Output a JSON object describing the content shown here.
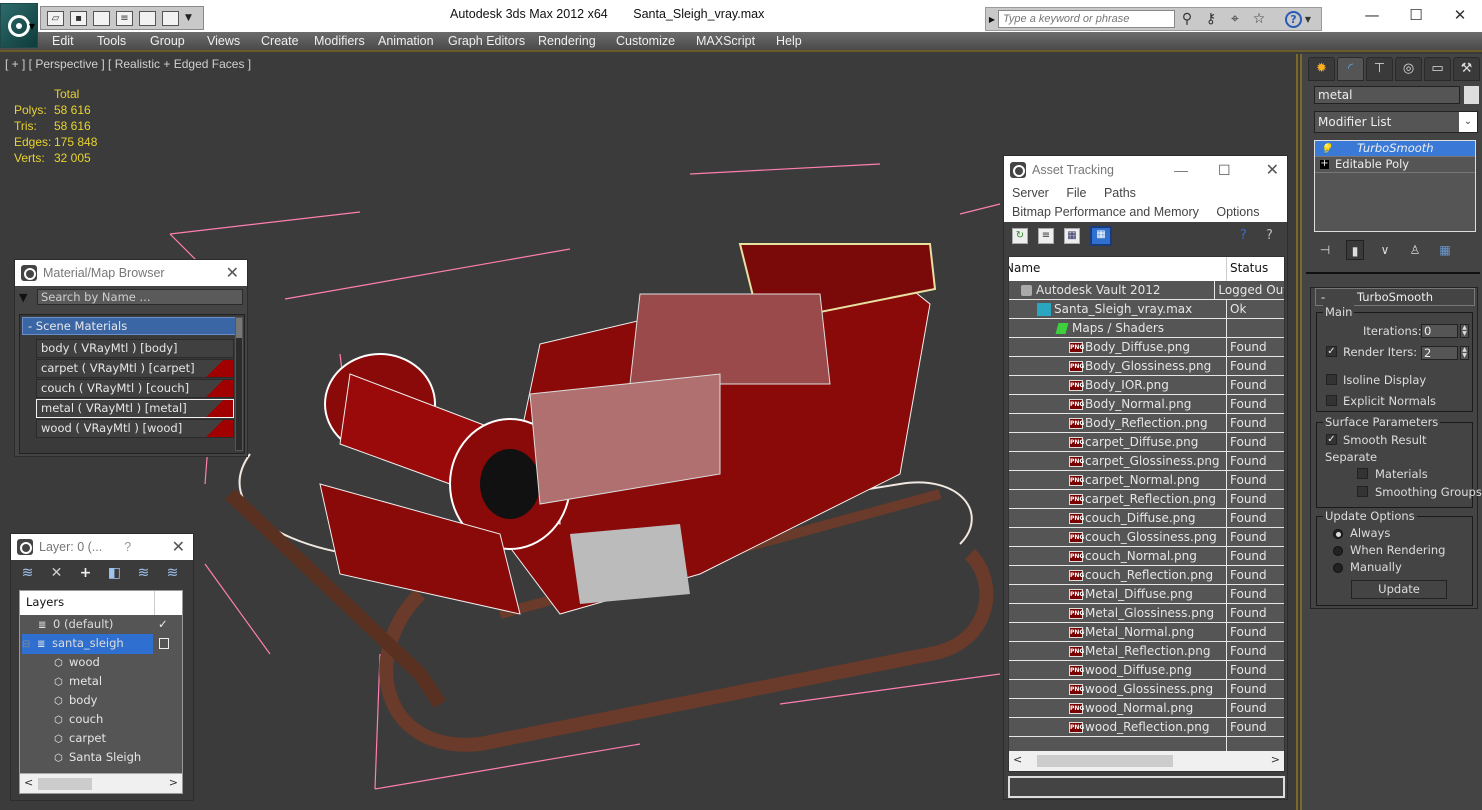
{
  "titlebar": {
    "app_name": "Autodesk 3ds Max  2012 x64",
    "file_name": "Santa_Sleigh_vray.max",
    "search_placeholder": "Type a keyword or phrase",
    "icons": [
      "search-binoculars-icon",
      "key-icon",
      "satellite-icon",
      "star-icon",
      "help-icon"
    ],
    "window_controls": [
      "minimize",
      "maximize",
      "close"
    ]
  },
  "quick_access": [
    "open-icon",
    "save-icon",
    "new-icon",
    "project-icon",
    "undo-icon",
    "redo-icon",
    "dropdown-icon"
  ],
  "menu": [
    "Edit",
    "Tools",
    "Group",
    "Views",
    "Create",
    "Modifiers",
    "Animation",
    "Graph Editors",
    "Rendering",
    "Customize",
    "MAXScript",
    "Help"
  ],
  "viewport": {
    "label": "[ + ] [ Perspective ] [ Realistic + Edged Faces ]",
    "stats": {
      "header": "Total",
      "rows": [
        {
          "key": "Polys:",
          "value": "58 616"
        },
        {
          "key": "Tris:",
          "value": "58 616"
        },
        {
          "key": "Edges:",
          "value": "175 848"
        },
        {
          "key": "Verts:",
          "value": "32 005"
        }
      ]
    }
  },
  "material_browser": {
    "title": "Material/Map Browser",
    "search_placeholder": "Search by Name ...",
    "group": "- Scene Materials",
    "items": [
      {
        "label": "body  ( VRayMtl ) [body]",
        "swatch": false,
        "selected": false
      },
      {
        "label": "carpet  ( VRayMtl ) [carpet]",
        "swatch": true,
        "selected": false
      },
      {
        "label": "couch  ( VRayMtl ) [couch]",
        "swatch": true,
        "selected": false
      },
      {
        "label": "metal  ( VRayMtl ) [metal]",
        "swatch": true,
        "selected": true
      },
      {
        "label": "wood  ( VRayMtl ) [wood]",
        "swatch": true,
        "selected": false
      }
    ]
  },
  "layer_explorer": {
    "title": "Layer: 0 (...",
    "help": "?",
    "header": "Layers",
    "rows": [
      {
        "label": "0 (default)",
        "type": "layer",
        "indent": 1,
        "selected": false,
        "state": "check"
      },
      {
        "label": "santa_sleigh",
        "type": "layer",
        "indent": 0,
        "selected": true,
        "state": "box"
      },
      {
        "label": "wood",
        "type": "object",
        "indent": 2
      },
      {
        "label": "metal",
        "type": "object",
        "indent": 2
      },
      {
        "label": "body",
        "type": "object",
        "indent": 2
      },
      {
        "label": "couch",
        "type": "object",
        "indent": 2
      },
      {
        "label": "carpet",
        "type": "object",
        "indent": 2
      },
      {
        "label": "Santa Sleigh",
        "type": "object",
        "indent": 2
      }
    ]
  },
  "asset_tracking": {
    "title": "Asset Tracking",
    "menu1": [
      "Server",
      "File",
      "Paths"
    ],
    "menu2": [
      "Bitmap Performance and Memory",
      "Options"
    ],
    "columns": [
      "Name",
      "Status"
    ],
    "rows": [
      {
        "name": "Autodesk Vault 2012",
        "status": "Logged Out",
        "icon": "vault",
        "indent": 1
      },
      {
        "name": "Santa_Sleigh_vray.max",
        "status": "Ok",
        "icon": "max",
        "indent": 2
      },
      {
        "name": "Maps / Shaders",
        "status": "",
        "icon": "maps",
        "indent": 3
      },
      {
        "name": "Body_Diffuse.png",
        "status": "Found",
        "icon": "png",
        "indent": 4
      },
      {
        "name": "Body_Glossiness.png",
        "status": "Found",
        "icon": "png",
        "indent": 4
      },
      {
        "name": "Body_IOR.png",
        "status": "Found",
        "icon": "png",
        "indent": 4
      },
      {
        "name": "Body_Normal.png",
        "status": "Found",
        "icon": "png",
        "indent": 4
      },
      {
        "name": "Body_Reflection.png",
        "status": "Found",
        "icon": "png",
        "indent": 4
      },
      {
        "name": "carpet_Diffuse.png",
        "status": "Found",
        "icon": "png",
        "indent": 4
      },
      {
        "name": "carpet_Glossiness.png",
        "status": "Found",
        "icon": "png",
        "indent": 4
      },
      {
        "name": "carpet_Normal.png",
        "status": "Found",
        "icon": "png",
        "indent": 4
      },
      {
        "name": "carpet_Reflection.png",
        "status": "Found",
        "icon": "png",
        "indent": 4
      },
      {
        "name": "couch_Diffuse.png",
        "status": "Found",
        "icon": "png",
        "indent": 4
      },
      {
        "name": "couch_Glossiness.png",
        "status": "Found",
        "icon": "png",
        "indent": 4
      },
      {
        "name": "couch_Normal.png",
        "status": "Found",
        "icon": "png",
        "indent": 4
      },
      {
        "name": "couch_Reflection.png",
        "status": "Found",
        "icon": "png",
        "indent": 4
      },
      {
        "name": "Metal_Diffuse.png",
        "status": "Found",
        "icon": "png",
        "indent": 4
      },
      {
        "name": "Metal_Glossiness.png",
        "status": "Found",
        "icon": "png",
        "indent": 4
      },
      {
        "name": "Metal_Normal.png",
        "status": "Found",
        "icon": "png",
        "indent": 4
      },
      {
        "name": "Metal_Reflection.png",
        "status": "Found",
        "icon": "png",
        "indent": 4
      },
      {
        "name": "wood_Diffuse.png",
        "status": "Found",
        "icon": "png",
        "indent": 4
      },
      {
        "name": "wood_Glossiness.png",
        "status": "Found",
        "icon": "png",
        "indent": 4
      },
      {
        "name": "wood_Normal.png",
        "status": "Found",
        "icon": "png",
        "indent": 4
      },
      {
        "name": "wood_Reflection.png",
        "status": "Found",
        "icon": "png",
        "indent": 4
      }
    ]
  },
  "command_panel": {
    "tabs": [
      "create",
      "modify",
      "hierarchy",
      "motion",
      "display",
      "utilities"
    ],
    "object_name": "metal",
    "modifier_list": "Modifier List",
    "stack": [
      {
        "label": "TurboSmooth",
        "selected": true
      },
      {
        "label": "Editable Poly",
        "selected": false
      }
    ],
    "rollout": {
      "title": "TurboSmooth",
      "main_label": "Main",
      "iterations_label": "Iterations:",
      "iterations": "0",
      "render_iters_label": "Render Iters:",
      "render_iters": "2",
      "render_iters_checked": true,
      "isoline_label": "Isoline Display",
      "explicit_label": "Explicit Normals",
      "surface_label": "Surface Parameters",
      "smooth_result_label": "Smooth Result",
      "separate_label": "Separate",
      "materials_label": "Materials",
      "smoothing_groups_label": "Smoothing Groups",
      "update_options_label": "Update Options",
      "always_label": "Always",
      "when_rendering_label": "When Rendering",
      "manually_label": "Manually",
      "update_button": "Update",
      "selected_update_option": "Always"
    }
  },
  "colors": {
    "accent_blue": "#3a7ad6",
    "stats_yellow": "#e8d230",
    "material_red": "#a00000",
    "viewport_bg": "#3b3b3b",
    "bbox_pink": "#ff7fb0"
  }
}
